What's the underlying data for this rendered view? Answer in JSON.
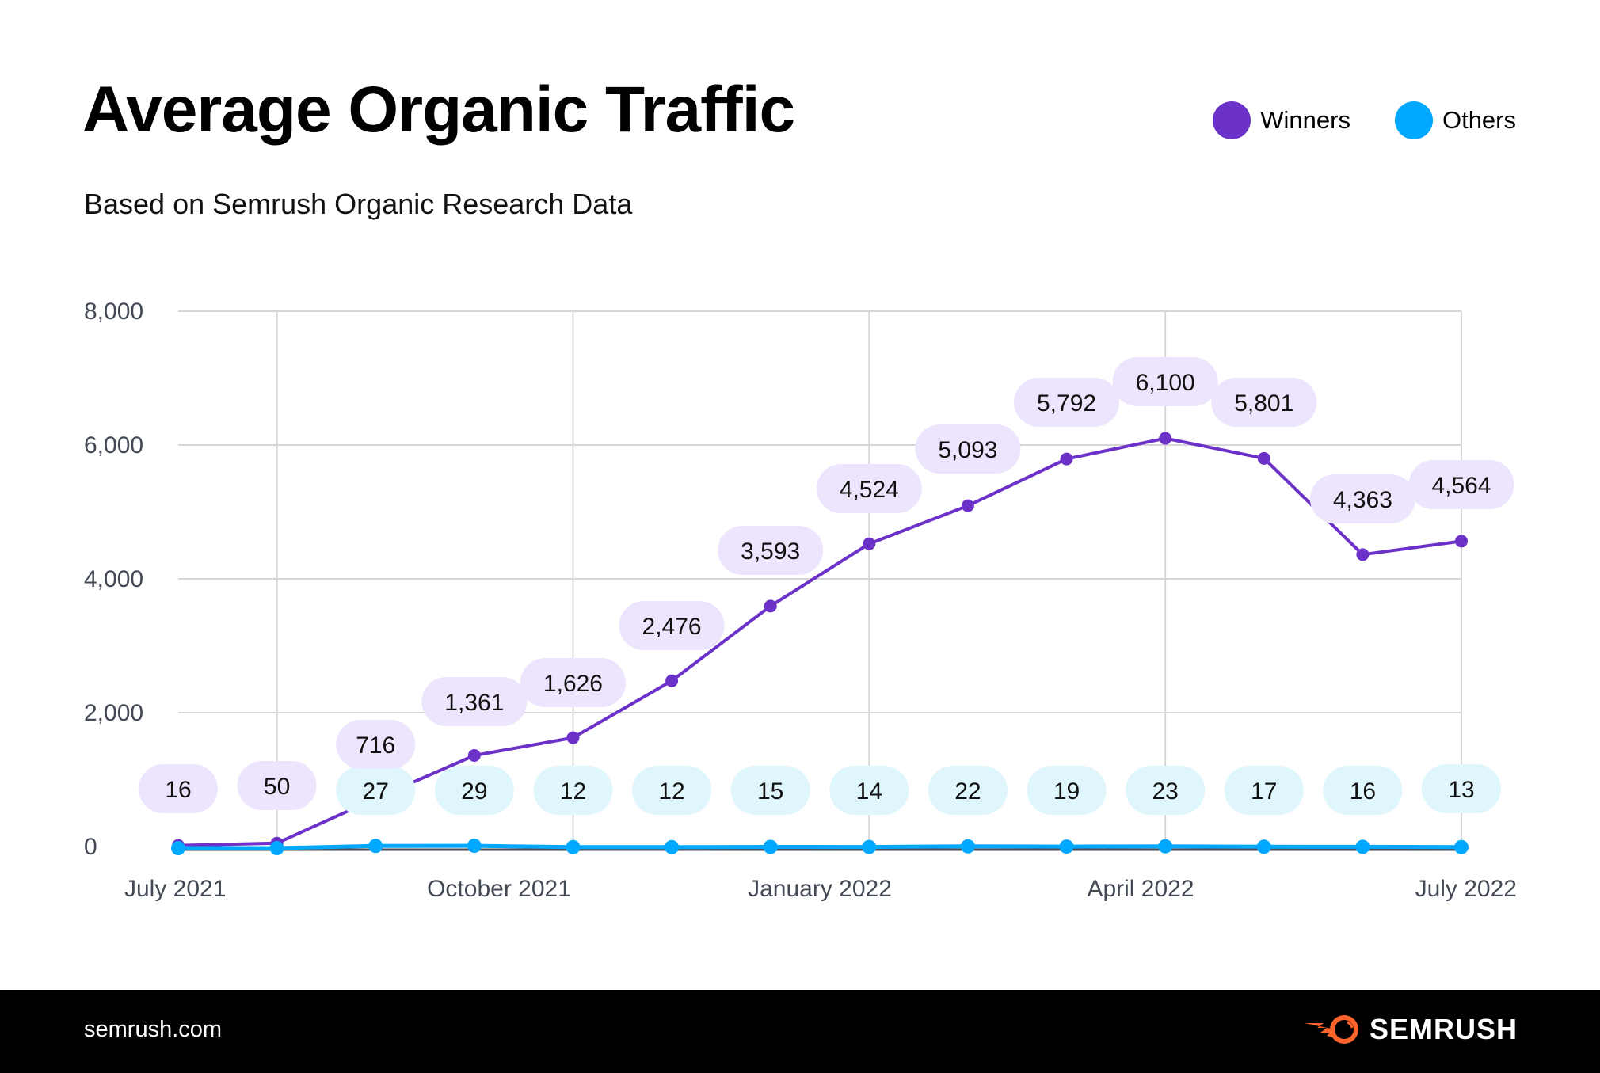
{
  "header": {
    "title": "Average Organic Traffic",
    "subtitle": "Based on Semrush Organic Research Data"
  },
  "legend": [
    {
      "name": "Winners",
      "color": "#6c31c8"
    },
    {
      "name": "Others",
      "color": "#00a8ff"
    }
  ],
  "colors": {
    "winners": "#6c31c8",
    "winners_label_bg": "#ede5fd",
    "others": "#00a8ff",
    "others_label_bg": "#e0f6fd",
    "grid": "#d6d6d6",
    "baseline": "#4a4f5a"
  },
  "footer": {
    "url": "semrush.com",
    "brand": "SEMRUSH",
    "brand_color": "#ff642d"
  },
  "chart_data": {
    "type": "line",
    "title": "Average Organic Traffic",
    "subtitle": "Based on Semrush Organic Research Data",
    "xlabel": "",
    "ylabel": "",
    "ylim": [
      0,
      8000
    ],
    "yticks": [
      0,
      2000,
      4000,
      6000,
      8000
    ],
    "ytick_labels": [
      "0",
      "2,000",
      "4,000",
      "6,000",
      "8,000"
    ],
    "x_count": 14,
    "xtick_labels": [
      {
        "index": 0,
        "label": "July 2021"
      },
      {
        "index": 3.25,
        "label": "October 2021"
      },
      {
        "index": 6.5,
        "label": "January 2022"
      },
      {
        "index": 9.75,
        "label": "April 2022"
      },
      {
        "index": 13,
        "label": "July 2022"
      }
    ],
    "vertical_grid_indices": [
      1,
      4,
      7,
      10,
      13
    ],
    "grid": true,
    "legend_position": "top-right",
    "series": [
      {
        "name": "Winners",
        "values": [
          16,
          50,
          716,
          1361,
          1626,
          2476,
          3593,
          4524,
          5093,
          5792,
          6100,
          5801,
          4363,
          4564
        ],
        "labels": [
          "16",
          "50",
          "716",
          "1,361",
          "1,626",
          "2,476",
          "3,593",
          "4,524",
          "5,093",
          "5,792",
          "6,100",
          "5,801",
          "4,363",
          "4,564"
        ]
      },
      {
        "name": "Others",
        "values": [
          null,
          null,
          27,
          29,
          12,
          12,
          15,
          14,
          22,
          19,
          23,
          17,
          16,
          13
        ],
        "labels": [
          null,
          null,
          "27",
          "29",
          "12",
          "12",
          "15",
          "14",
          "22",
          "19",
          "23",
          "17",
          "16",
          "13"
        ]
      }
    ]
  }
}
